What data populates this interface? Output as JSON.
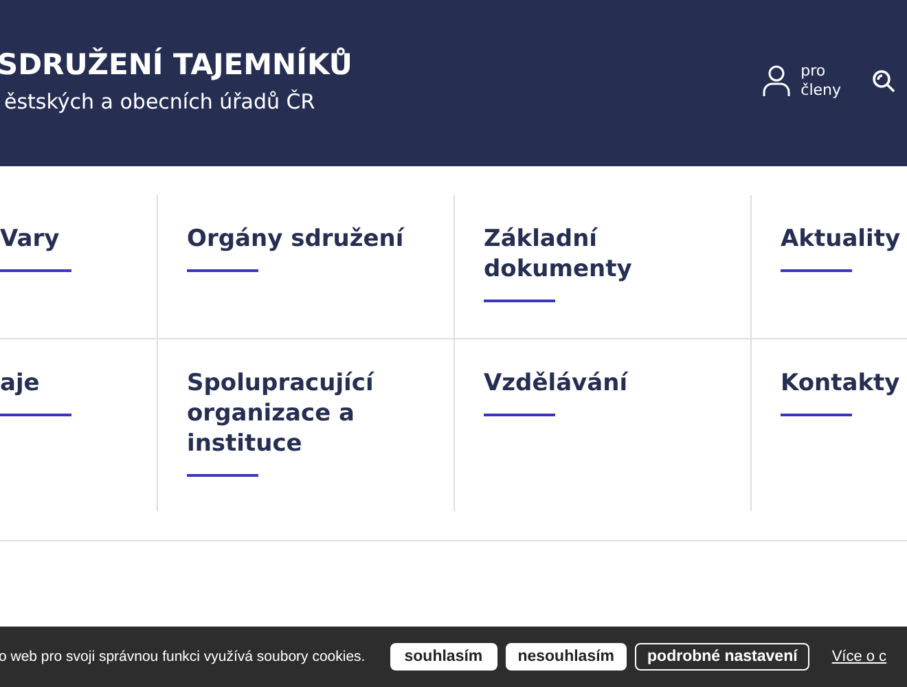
{
  "header": {
    "title": "SDRUŽENÍ TAJEMNÍKŮ",
    "subtitle": "ěstských a obecních úřadů ČR",
    "member_link": {
      "line1": "pro",
      "line2": "členy"
    }
  },
  "nav_tiles": [
    [
      {
        "label": "Vary"
      },
      {
        "label": "Orgány sdružení"
      },
      {
        "label": "Základní dokumenty"
      },
      {
        "label": "Aktuality"
      }
    ],
    [
      {
        "label": "aje"
      },
      {
        "label": "Spolupracující organizace a instituce"
      },
      {
        "label": "Vzdělávání"
      },
      {
        "label": "Kontakty"
      }
    ]
  ],
  "cookie_bar": {
    "text": "o web pro svoji správnou funkci využívá soubory cookies.",
    "buttons": [
      {
        "label": "souhlasím",
        "kind": "solid"
      },
      {
        "label": "nesouhlasím",
        "kind": "solid"
      },
      {
        "label": "podrobné nastavení",
        "kind": "outline"
      }
    ],
    "link": "Více o c"
  }
}
